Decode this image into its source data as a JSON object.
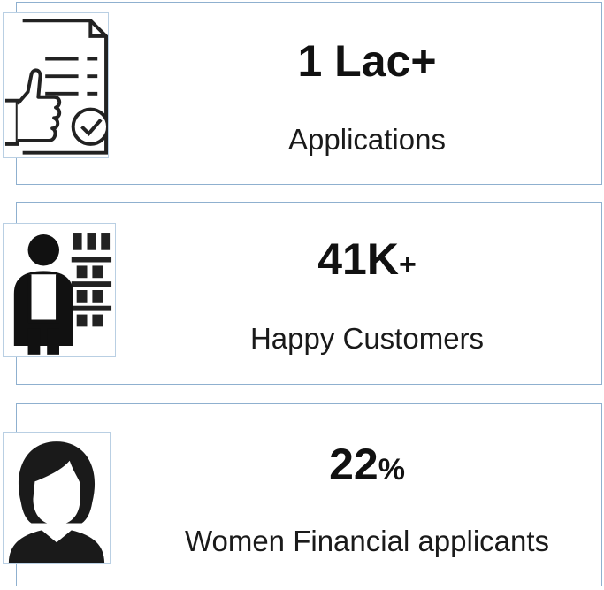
{
  "stats": [
    {
      "value": "1 Lac+",
      "suffix": "",
      "label": "Applications",
      "icon": "approved-document-thumbs-up-icon"
    },
    {
      "value": "41K",
      "suffix": "+",
      "label": "Happy Customers",
      "icon": "shopkeeper-customer-icon"
    },
    {
      "value": "22",
      "suffix": "%",
      "label": "Women Financial applicants",
      "icon": "woman-avatar-icon"
    }
  ],
  "colors": {
    "card_border": "#8fb0cf",
    "icon_border": "#b9cfe3",
    "text": "#111111"
  }
}
